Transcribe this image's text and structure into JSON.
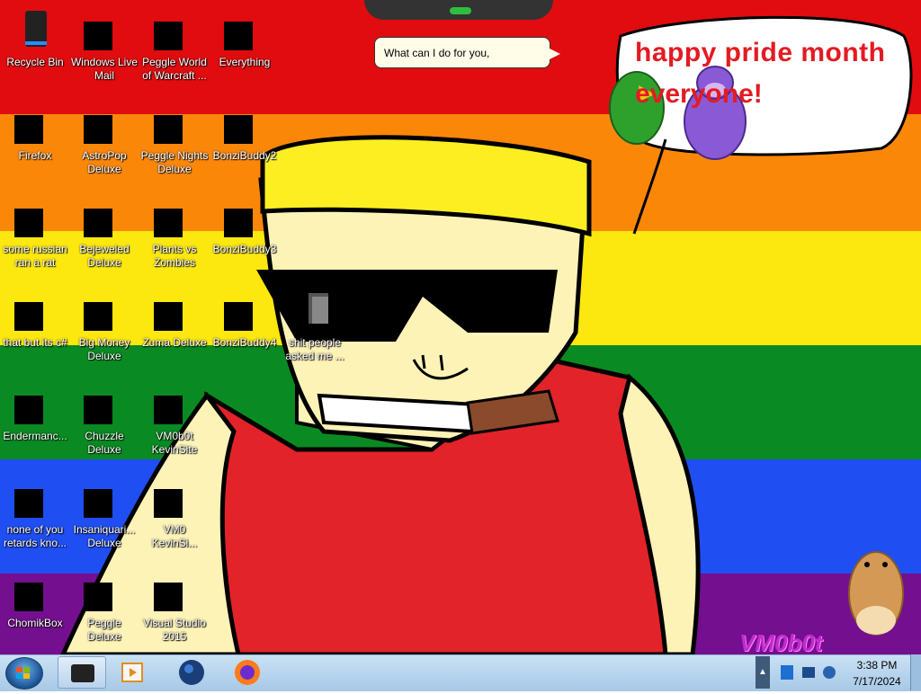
{
  "desktop": {
    "icons": [
      {
        "label": "Recycle Bin",
        "icon": "recycle-bin-icon"
      },
      {
        "label": "Windows Live Mail",
        "icon": "mail-icon"
      },
      {
        "label": "Peggle World of Warcraft ...",
        "icon": "game-icon"
      },
      {
        "label": "Everything",
        "icon": "search-app-icon"
      },
      {
        "label": "Firefox",
        "icon": "firefox-icon"
      },
      {
        "label": "AstroPop Deluxe",
        "icon": "game-icon"
      },
      {
        "label": "Peggle Nights Deluxe",
        "icon": "game-icon"
      },
      {
        "label": "BonziBuddy2",
        "icon": "folder-icon"
      },
      {
        "label": "some russian ran a rat",
        "icon": "file-icon"
      },
      {
        "label": "Bejeweled Deluxe",
        "icon": "gem-icon"
      },
      {
        "label": "Plants vs Zombies",
        "icon": "game-icon"
      },
      {
        "label": "BonziBuddy3",
        "icon": "bonzi-icon"
      },
      {
        "label": "that but its c#",
        "icon": "file-icon"
      },
      {
        "label": "Big Money Deluxe",
        "icon": "money-bag-icon"
      },
      {
        "label": "Zuma Deluxe",
        "icon": "game-icon"
      },
      {
        "label": "BonziBuddy4",
        "icon": "bonzi-icon"
      },
      {
        "label": "Endermanc...",
        "icon": "terminal-icon"
      },
      {
        "label": "Chuzzle Deluxe",
        "icon": "game-icon"
      },
      {
        "label": "VM0b0t KevinSite",
        "icon": "folder-icon"
      },
      {
        "label": "none of you retards kno...",
        "icon": "browser-icon"
      },
      {
        "label": "Insaniquari... Deluxe",
        "icon": "fish-icon"
      },
      {
        "label": "VM0 KevinSi...",
        "icon": "file-icon"
      },
      {
        "label": "ChomikBox",
        "icon": "hamster-icon"
      },
      {
        "label": "Peggle Deluxe",
        "icon": "game-icon"
      },
      {
        "label": "Visual Studio 2015",
        "icon": "visual-studio-icon"
      },
      {
        "label": "shit people asked me ...",
        "icon": "folder-icon"
      }
    ]
  },
  "assistant_bubble": {
    "text": "What can I do for you,"
  },
  "wallpaper": {
    "cloud_line1": "happy pride month",
    "cloud_line2": "everyone!",
    "watermark": "VM0b0t"
  },
  "taskbar": {
    "start_label": "Start",
    "pinned": [
      {
        "name": "computer-icon"
      },
      {
        "name": "media-player-icon"
      },
      {
        "name": "earth-icon"
      },
      {
        "name": "firefox-icon"
      }
    ],
    "clock_time": "3:38 PM",
    "clock_date": "7/17/2024"
  },
  "colors": {
    "stripe_red": "#e10c0f",
    "stripe_orange": "#fb8709",
    "stripe_yellow": "#fce80e",
    "stripe_green": "#0a8a23",
    "stripe_blue": "#1f4ef2",
    "stripe_purple": "#740f8f",
    "taskbar": "#b9d3ec"
  }
}
